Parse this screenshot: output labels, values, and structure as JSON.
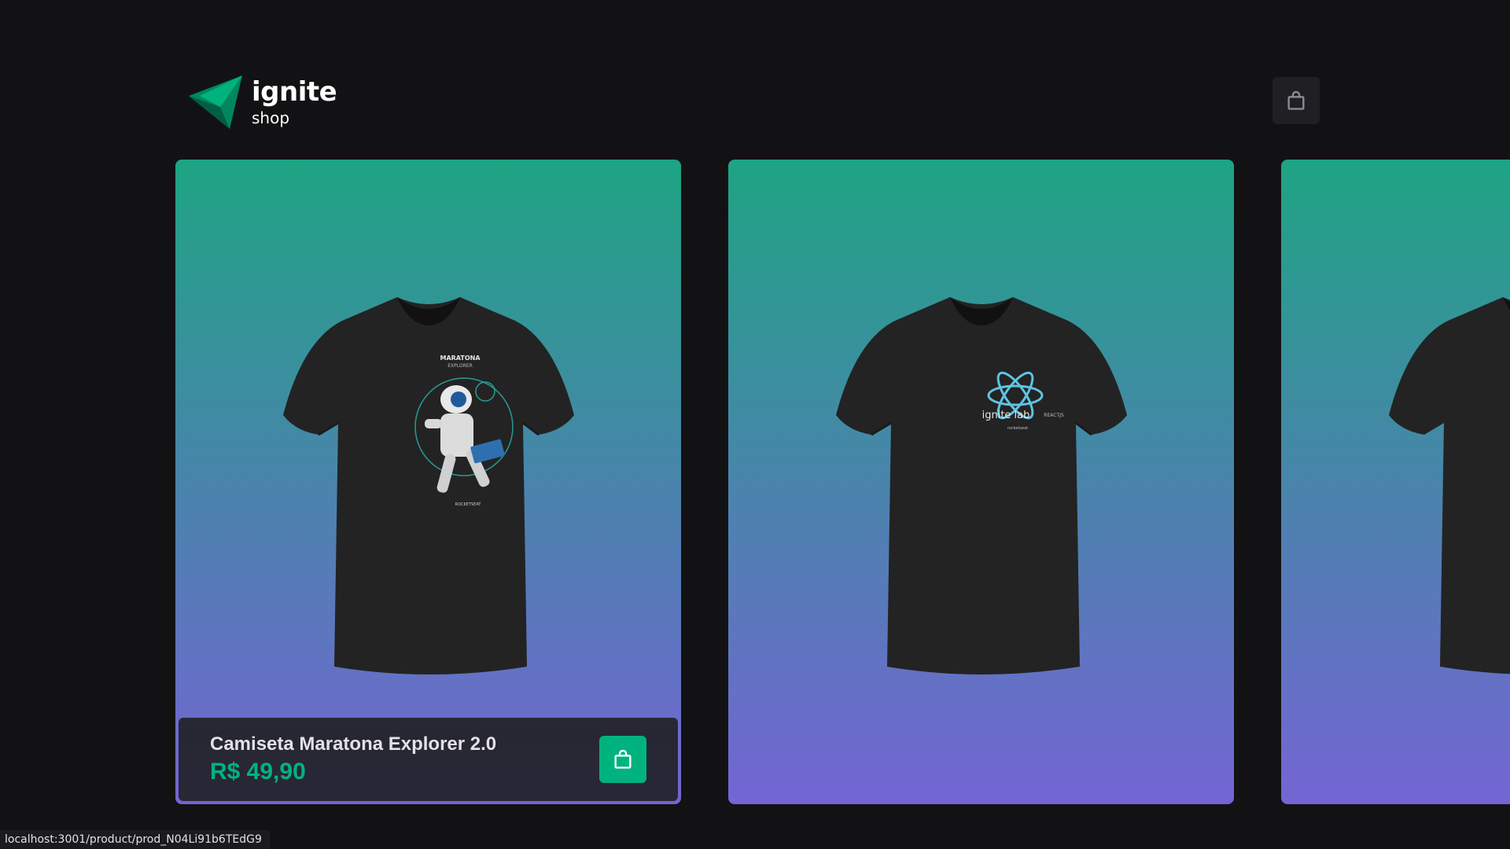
{
  "header": {
    "logo_title": "ignite",
    "logo_subtitle": "shop",
    "cart_icon": "shopping-bag-icon"
  },
  "products": [
    {
      "name": "Camiseta Maratona Explorer 2.0",
      "price": "R$ 49,90",
      "print_title": "MARATONA",
      "print_subtitle": "EXPLORER",
      "print_brand": "ROCKETSEAT",
      "footer_visible": true
    },
    {
      "print_title": "ignite lab",
      "print_subtitle": "REACTJS",
      "print_brand": "rocketseat",
      "footer_visible": false
    },
    {
      "footer_visible": false
    }
  ],
  "status_bar": {
    "url": "localhost:3001/product/prod_N04Li91b6TEdG9"
  },
  "colors": {
    "background": "#121214",
    "gradient_top": "#1ea483",
    "gradient_bottom": "#7465d4",
    "accent": "#00b37e",
    "surface": "#202024"
  }
}
